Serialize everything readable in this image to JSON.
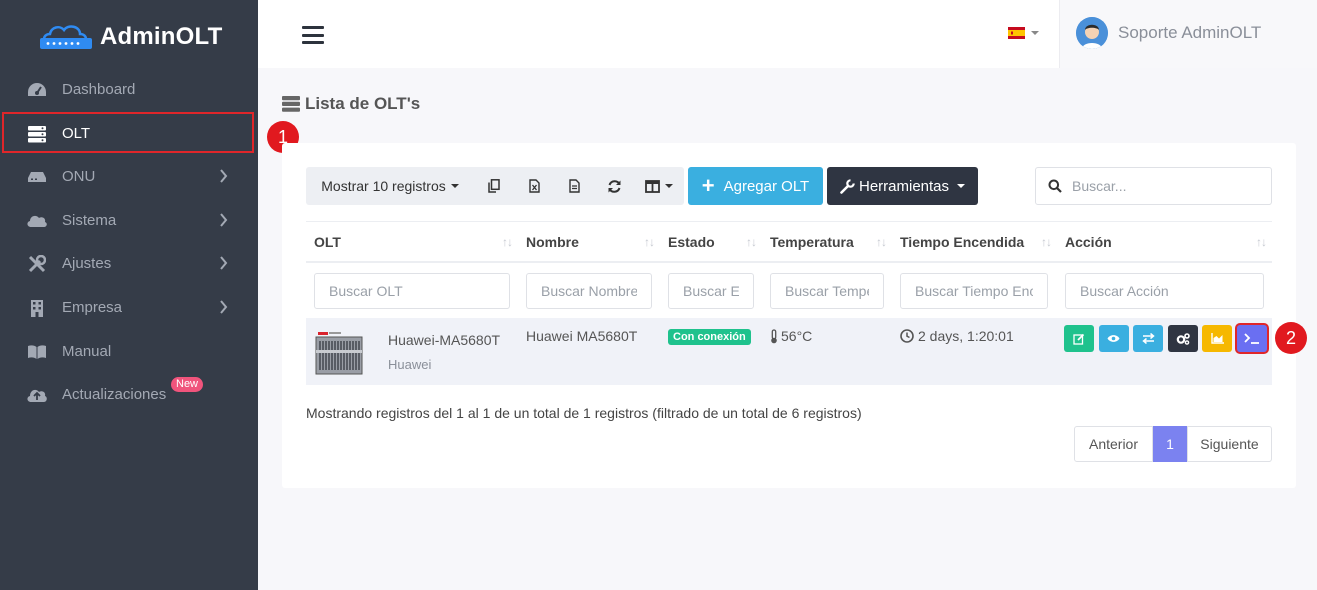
{
  "brand": {
    "name": "AdminOLT"
  },
  "sidebar": {
    "items": [
      {
        "label": "Dashboard"
      },
      {
        "label": "OLT"
      },
      {
        "label": "ONU"
      },
      {
        "label": "Sistema"
      },
      {
        "label": "Ajustes"
      },
      {
        "label": "Empresa"
      },
      {
        "label": "Manual"
      },
      {
        "label": "Actualizaciones",
        "badge": "New"
      }
    ]
  },
  "markers": {
    "one": "1",
    "two": "2"
  },
  "header": {
    "user_name": "Soporte AdminOLT"
  },
  "page": {
    "title": "Lista de OLT's"
  },
  "toolbar": {
    "show_label": "Mostrar 10 registros",
    "add_label": "Agregar OLT",
    "tools_label": "Herramientas",
    "search_placeholder": "Buscar..."
  },
  "table": {
    "columns": [
      "OLT",
      "Nombre",
      "Estado",
      "Temperatura",
      "Tiempo Encendida",
      "Acción"
    ],
    "filter_placeholders": [
      "Buscar OLT",
      "Buscar Nombre",
      "Buscar Estado",
      "Buscar Temperatura",
      "Buscar Tiempo Encendida",
      "Buscar Acción"
    ],
    "rows": [
      {
        "olt_model": "Huawei-MA5680T",
        "olt_vendor": "Huawei",
        "name": "Huawei MA5680T",
        "status": "Con conexión",
        "temperature": "56°C",
        "uptime": "2 days, 1:20:01"
      }
    ]
  },
  "footer": {
    "info": "Mostrando registros del 1 al 1 de un total de 1 registros (filtrado de un total de 6 registros)",
    "prev": "Anterior",
    "page": "1",
    "next": "Siguiente"
  },
  "colors": {
    "sidebar": "#353c48",
    "accent_blue": "#3aafe0",
    "dark_button": "#2f3542",
    "status_green": "#1fc28d",
    "pager_active": "#7b82f0",
    "highlight_red": "#e0262a",
    "action_edit": "#1fc28d",
    "action_view": "#3aafe0",
    "action_transfer": "#3aafe0",
    "action_config": "#2f3542",
    "action_chart": "#f6b800",
    "action_terminal": "#6a6ff2"
  }
}
